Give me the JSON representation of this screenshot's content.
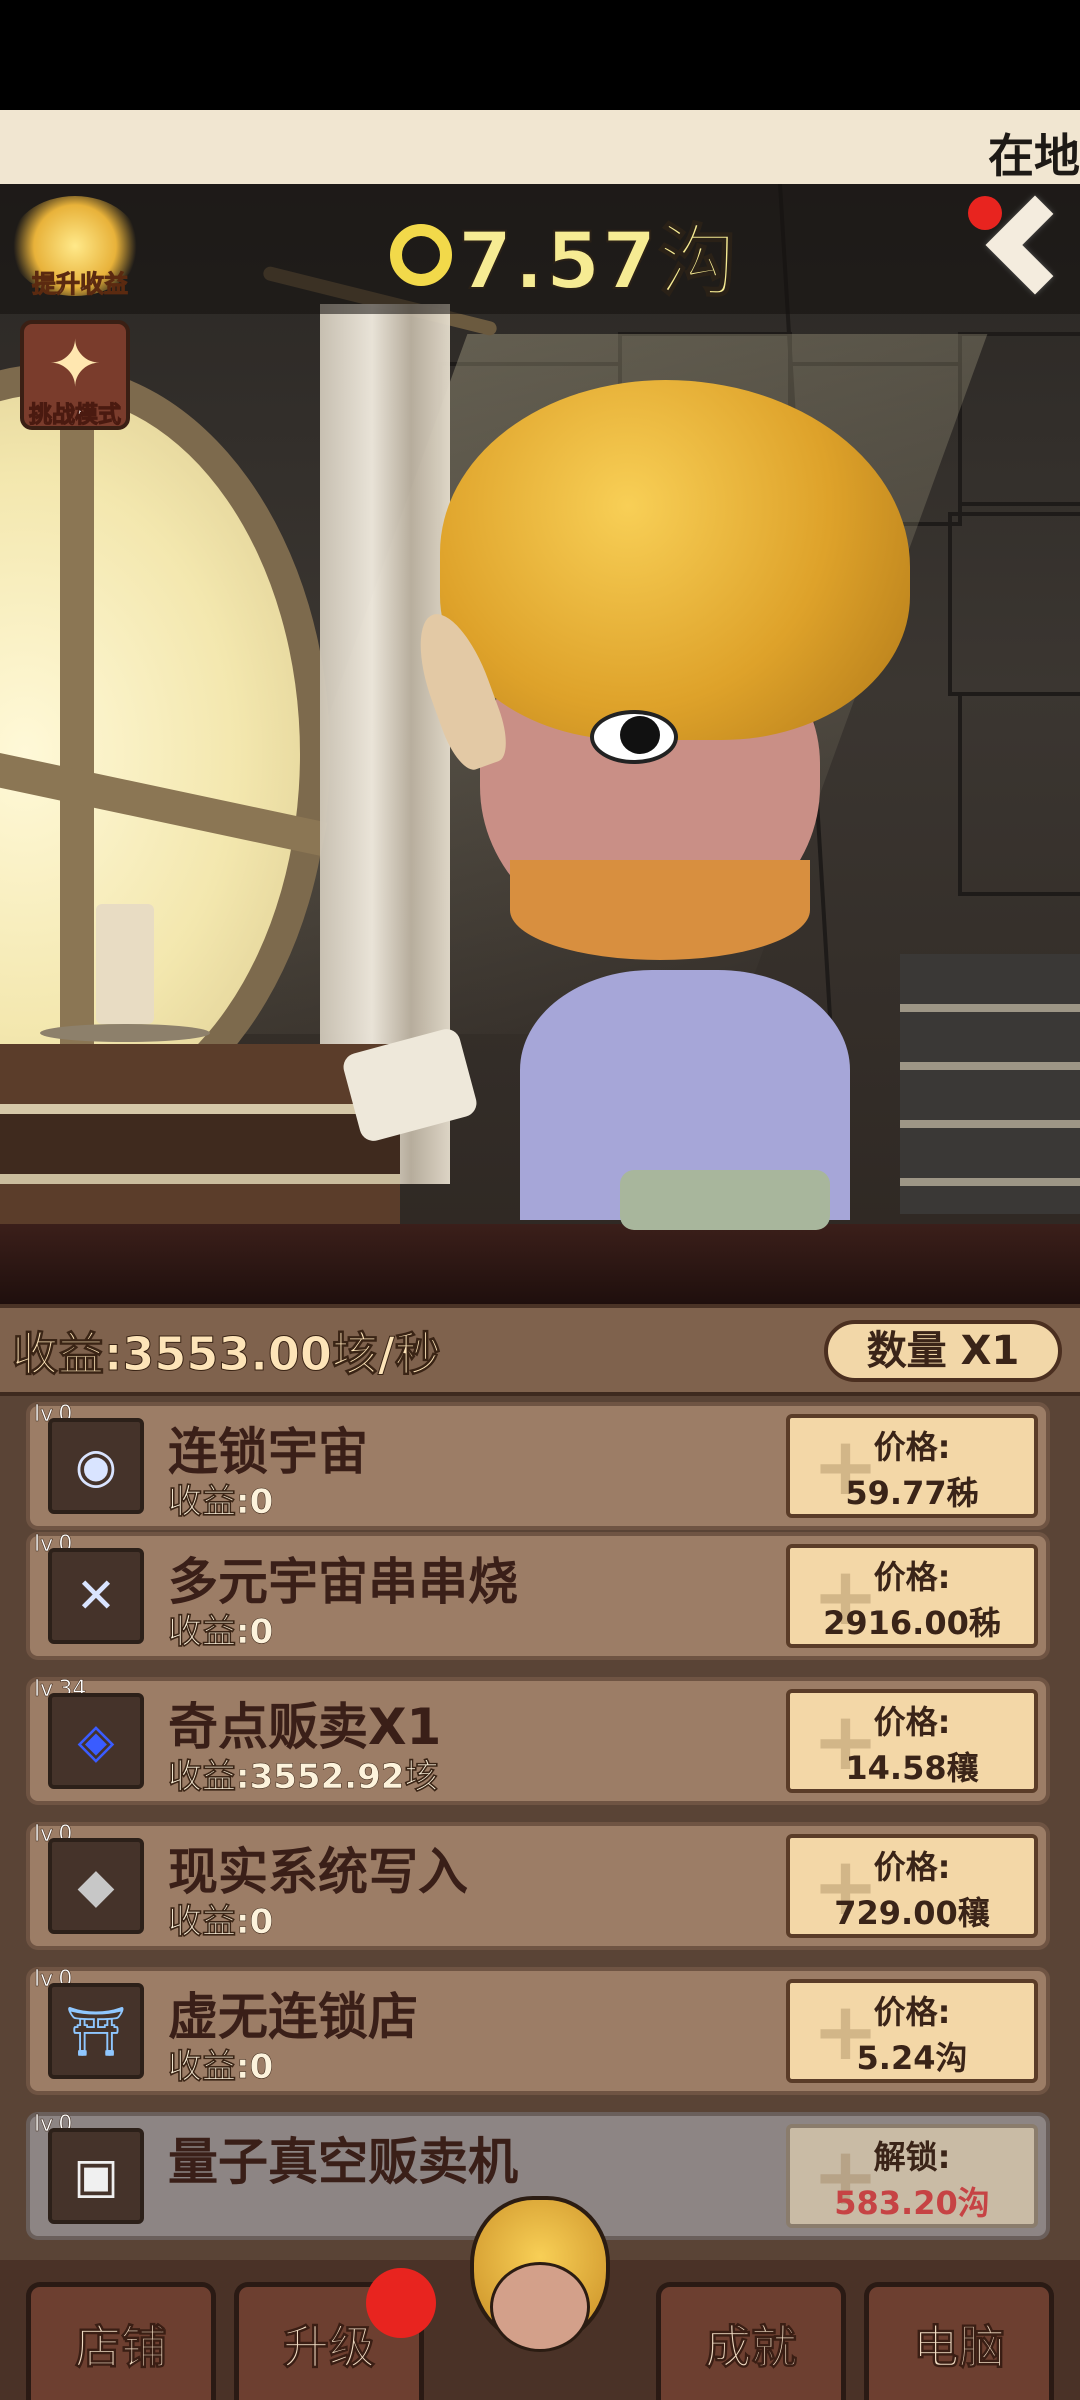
{
  "marquee": {
    "text": "在地"
  },
  "header": {
    "currency_value": "7.57沟",
    "boost_label": "提升收益",
    "challenge_label": "挑战模式"
  },
  "income_bar": {
    "income_text": "收益:3553.00垓/秒",
    "quantity_label": "数量 X1"
  },
  "items": [
    {
      "level": "lv.0",
      "name": "连锁宇宙",
      "income": "收益:0",
      "price_label": "价格:",
      "price": "59.77秭",
      "icon": "eye-galaxy-icon",
      "locked": false
    },
    {
      "level": "lv.0",
      "name": "多元宇宙串串烧",
      "income": "收益:0",
      "price_label": "价格:",
      "price": "2916.00秭",
      "icon": "cosmic-skewer-icon",
      "locked": false
    },
    {
      "level": "lv.34",
      "name": "奇点贩卖X1",
      "income": "收益:3552.92垓",
      "price_label": "价格:",
      "price": "14.58穰",
      "icon": "singularity-icon",
      "locked": false
    },
    {
      "level": "lv.0",
      "name": "现实系统写入",
      "income": "收益:0",
      "price_label": "价格:",
      "price": "729.00穰",
      "icon": "reality-writer-icon",
      "locked": false
    },
    {
      "level": "lv.0",
      "name": "虚无连锁店",
      "income": "收益:0",
      "price_label": "价格:",
      "price": "5.24沟",
      "icon": "void-shop-icon",
      "locked": false
    },
    {
      "level": "lv.0",
      "name": "量子真空贩卖机",
      "income": "",
      "price_label": "解锁:",
      "price": "583.20沟",
      "icon": "quantum-vending-icon",
      "locked": true
    }
  ],
  "nav": {
    "tabs": [
      {
        "label": "店铺"
      },
      {
        "label": "升级"
      },
      {
        "label": "成就"
      },
      {
        "label": "电脑"
      }
    ]
  },
  "colors": {
    "currency_text": "#f6eb93",
    "badge_red": "#e8241f",
    "locked_price": "#c64344",
    "panel": "#5a4436"
  }
}
